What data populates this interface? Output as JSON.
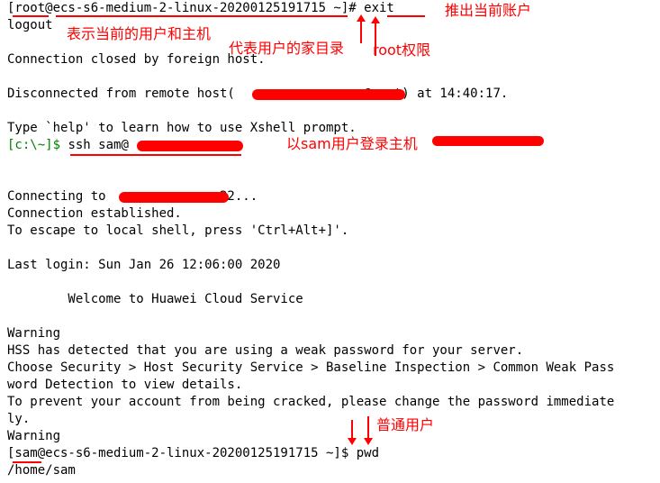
{
  "terminal": {
    "lines": [
      "[root@ecs-s6-medium-2-linux-20200125191715 ~]# exit",
      "logout",
      "",
      "Connection closed by foreign host.",
      "",
      "Disconnected from remote host(                 @root) at 14:40:17.",
      "",
      "Type `help' to learn how to use Xshell prompt.",
      "",
      "",
      "",
      "Connecting to              :22...",
      "Connection established.",
      "To escape to local shell, press 'Ctrl+Alt+]'.",
      "",
      "Last login: Sun Jan 26 12:06:00 2020",
      "",
      "        Welcome to Huawei Cloud Service",
      "",
      "Warning",
      "HSS has detected that you are using a weak password for your server.",
      "Choose Security > Host Security Service > Baseline Inspection > Common Weak Pass",
      "word Detection to view details.",
      "To prevent your account from being cracked, please change the password immediate",
      "ly.",
      "Warning",
      "[sam@ecs-s6-medium-2-linux-20200125191715 ~]$ pwd",
      "/home/sam"
    ],
    "local_prompt": "[c:\\~]$",
    "local_command": " ssh sam@"
  },
  "annotations": {
    "logout_current_account": "推出当前账户",
    "current_user_host": "表示当前的用户和主机",
    "user_home_dir": "代表用户的家目录",
    "root_privilege": "root权限",
    "login_as_sam": "以sam用户登录主机",
    "normal_user": "普通用户"
  },
  "colors": {
    "annotation": "#ff0000",
    "local_prompt": "#008000",
    "text": "#000000",
    "background": "#ffffff"
  }
}
